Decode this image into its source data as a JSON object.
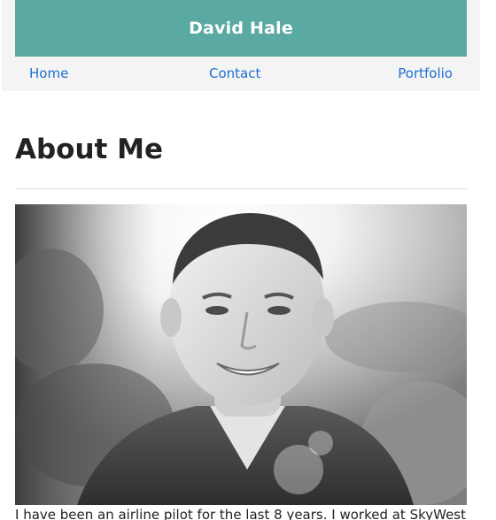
{
  "header": {
    "site_title": "David Hale",
    "brand_color": "#5aa9a3"
  },
  "nav": {
    "links": [
      {
        "label": "Home"
      },
      {
        "label": "Contact"
      },
      {
        "label": "Portfolio"
      }
    ],
    "link_color": "#1f6fd0"
  },
  "main": {
    "heading": "About Me",
    "photo_icon": "portrait-photo",
    "bio_text": "I have been an airline pilot for the last 8 years. I worked at SkyWest"
  }
}
